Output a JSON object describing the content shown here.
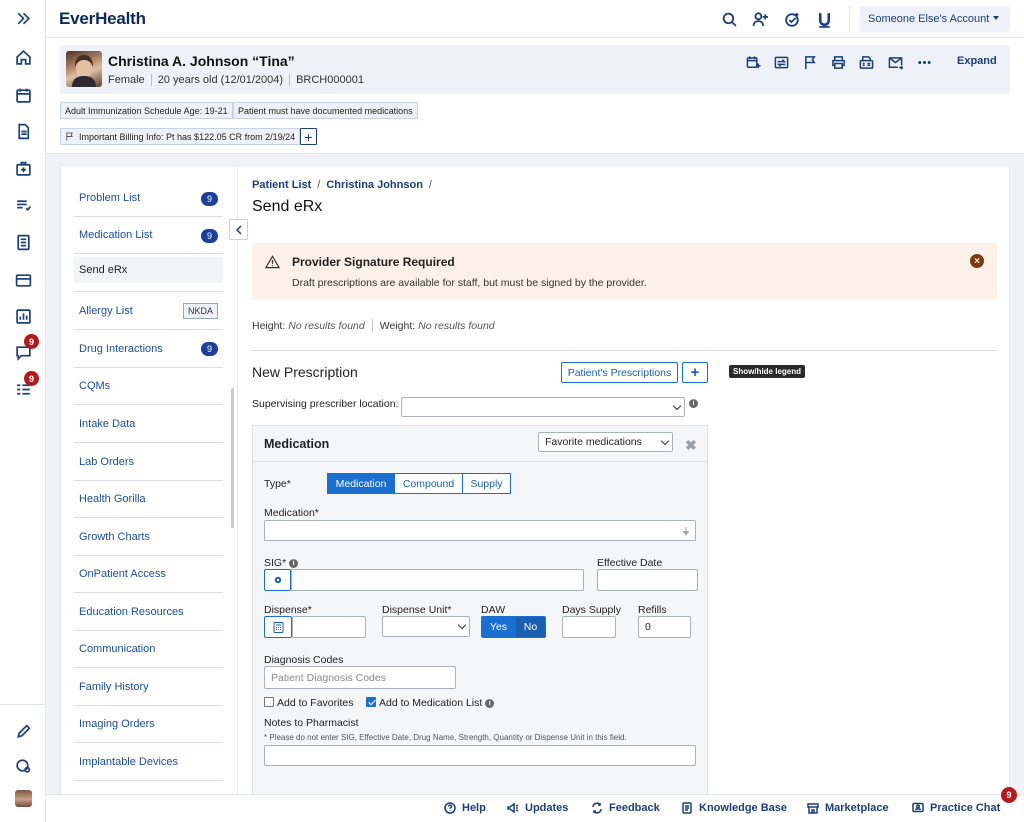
{
  "app": {
    "logo": "EverHealth",
    "account": "Someone Else's Account",
    "colors": {
      "brand": "#1b3f7a",
      "accent": "#1b6fd0",
      "badge": "#b3191d",
      "alert_bg": "#fdf0e8"
    }
  },
  "rail": {
    "items": [
      "expand-icon",
      "home-icon",
      "calendar-icon",
      "document-icon",
      "medical-bag-icon",
      "list-icon",
      "notes-icon",
      "card-icon",
      "chart-icon",
      "chat-icon",
      "tasks-icon"
    ],
    "badges": {
      "chat": "9",
      "tasks": "9"
    },
    "bottom": [
      "pencil-icon",
      "settings-icon",
      "user-avatar"
    ]
  },
  "top_icons": [
    "search-icon",
    "add-user-icon",
    "check-icon",
    "u-icon"
  ],
  "patient": {
    "name": "Christina A. Johnson “Tina”",
    "sex": "Female",
    "age": "20 years old (12/01/2004)",
    "id": "BRCH000001",
    "actions": [
      "calendar-add-icon",
      "switch-icon",
      "flag-icon",
      "print-icon",
      "fax-icon",
      "mail-icon",
      "more-icon"
    ],
    "expand_label": "Expand",
    "tags": [
      "Adult Immunization Schedule Age: 19-21",
      "Patient must have documented medications"
    ],
    "billing_tag": "Important Billing Info: Pt has $122.05 CR from 2/19/24"
  },
  "nav": {
    "items": [
      {
        "label": "Problem List",
        "badge": "9"
      },
      {
        "label": "Medication List",
        "badge": "9"
      },
      {
        "label": "Send eRx",
        "active": true
      },
      {
        "label": "Allergy List",
        "tag": "NKDA"
      },
      {
        "label": "Drug Interactions",
        "badge": "9"
      },
      {
        "label": "CQMs"
      },
      {
        "label": "Intake Data"
      },
      {
        "label": "Lab Orders"
      },
      {
        "label": "Health Gorilla"
      },
      {
        "label": "Growth Charts"
      },
      {
        "label": "OnPatient Access"
      },
      {
        "label": "Education Resources"
      },
      {
        "label": "Communication"
      },
      {
        "label": "Family History"
      },
      {
        "label": "Imaging Orders"
      },
      {
        "label": "Implantable Devices"
      }
    ]
  },
  "breadcrumb": {
    "items": [
      "Patient List",
      "Christina Johnson"
    ],
    "sep": "/"
  },
  "page_title": "Send eRx",
  "alert": {
    "title": "Provider Signature Required",
    "body": "Draft prescriptions are available for staff, but must be signed by the provider."
  },
  "vitals": {
    "height_label": "Height:",
    "height_value": "No results found",
    "weight_label": "Weight:",
    "weight_value": "No results found"
  },
  "prescription": {
    "title": "New Prescription",
    "patients_prescriptions_btn": "Patient's Prescriptions",
    "add_btn": "+",
    "legend_tip": "Show/hide legend",
    "supervising_label": "Supervising prescriber location:",
    "supervising_value": ""
  },
  "medication": {
    "title": "Medication",
    "favorites_select": "Favorite medications",
    "type_label": "Type*",
    "types": [
      "Medication",
      "Compound",
      "Supply"
    ],
    "type_selected": "Medication",
    "medication_label": "Medication*",
    "medication_value": "",
    "sig_label": "SIG*",
    "sig_value": "",
    "effective_date_label": "Effective Date",
    "effective_date_value": "",
    "dispense_label": "Dispense*",
    "dispense_value": "",
    "dispense_unit_label": "Dispense Unit*",
    "dispense_unit_value": "",
    "daw_label": "DAW",
    "daw_yes": "Yes",
    "daw_no": "No",
    "days_supply_label": "Days Supply",
    "days_supply_value": "",
    "refills_label": "Refills",
    "refills_value": "0",
    "diagnosis_label": "Diagnosis Codes",
    "diagnosis_placeholder": "Patient Diagnosis Codes",
    "add_favorites_label": "Add to Favorites",
    "add_favorites_checked": false,
    "add_med_list_label": "Add to Medication List",
    "add_med_list_checked": true,
    "notes_label": "Notes to Pharmacist",
    "notes_hint": "* Please do not enter SIG, Effective Date, Drug Name, Strength, Quantity or Dispense Unit in this field.",
    "notes_value": ""
  },
  "footer": {
    "items": [
      "Help",
      "Updates",
      "Feedback",
      "Knowledge Base",
      "Marketplace",
      "Practice Chat"
    ],
    "practice_chat_badge": "9"
  }
}
